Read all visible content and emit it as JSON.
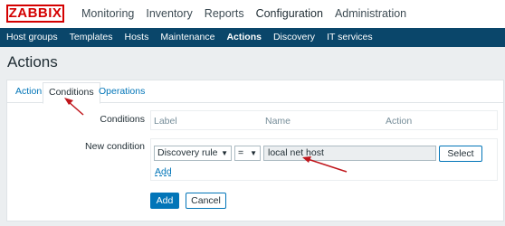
{
  "logo": "ZABBIX",
  "main_menu": [
    "Monitoring",
    "Inventory",
    "Reports",
    "Configuration",
    "Administration"
  ],
  "main_menu_active": "Configuration",
  "sub_menu": [
    "Host groups",
    "Templates",
    "Hosts",
    "Maintenance",
    "Actions",
    "Discovery",
    "IT services"
  ],
  "sub_menu_active": "Actions",
  "page_title": "Actions",
  "tabs": [
    "Action",
    "Conditions",
    "Operations"
  ],
  "active_tab": "Conditions",
  "conditions": {
    "label": "Conditions",
    "columns": [
      "Label",
      "Name",
      "Action"
    ]
  },
  "new_condition": {
    "label": "New condition",
    "type_select": "Discovery rule",
    "operator_select": "=",
    "value": "local net host",
    "select_button": "Select",
    "add_link": "Add"
  },
  "buttons": {
    "add": "Add",
    "cancel": "Cancel"
  },
  "colors": {
    "brand": "#d40000",
    "nav_bar": "#0a466a",
    "accent": "#0275b8",
    "annotation_arrow": "#c0161c"
  }
}
